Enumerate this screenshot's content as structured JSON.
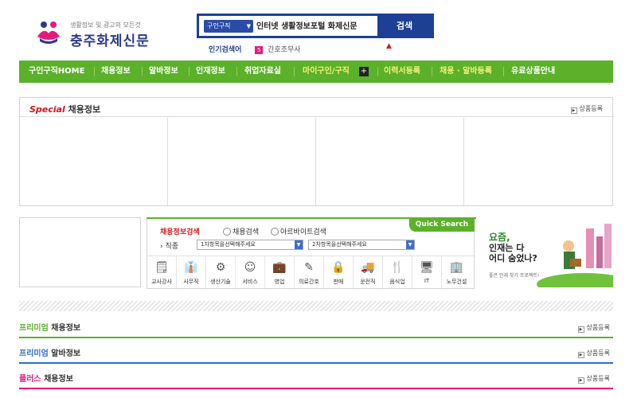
{
  "header": {
    "logo_tagline": "생활정보 및 광고의 모든것",
    "logo_name": "충주화제신문",
    "search": {
      "category": "구인구직",
      "query": "인터넷 생활정보포털 화제신문",
      "button": "검색"
    },
    "popular": {
      "label": "인기검색어",
      "rank": "5",
      "keyword": "간호조무사"
    }
  },
  "nav": {
    "items": [
      "구인구직HOME",
      "채용정보",
      "알바정보",
      "인재정보",
      "취업자료실",
      "마이구인/구직",
      "이력서등록",
      "채용 · 알바등록",
      "유료상품안내"
    ]
  },
  "special": {
    "title_accent": "Special",
    "title_rest": "채용정보",
    "register": "상품등록"
  },
  "job_search": {
    "title": "채용정보검색",
    "radio_job": "채용검색",
    "radio_alba": "아르바이트검색",
    "category_label": "직종",
    "dropdown1": "1차항목을선택해주세요",
    "dropdown2": "2차항목을선택해주세요",
    "quick": "Quick Search",
    "categories": [
      "교사강사",
      "사무직",
      "생산기술",
      "서비스",
      "영업",
      "의료간호",
      "판매",
      "운전직",
      "음식업",
      "IT",
      "노무건설"
    ]
  },
  "banner": {
    "line1": "요즘,",
    "line2": "인재는 다",
    "line3": "어디 숨었나?",
    "line4": "좋은 인재 찾기 프로젝트!"
  },
  "sections": [
    {
      "accent": "프리미엄",
      "rest": "채용정보",
      "color": "#5bb12a",
      "register": "상품등록"
    },
    {
      "accent": "프리미엄",
      "rest": "알바정보",
      "color": "#2a6fc9",
      "register": "상품등록"
    },
    {
      "accent": "플러스",
      "rest": "채용정보",
      "color": "#e6197f",
      "register": "상품등록"
    }
  ]
}
